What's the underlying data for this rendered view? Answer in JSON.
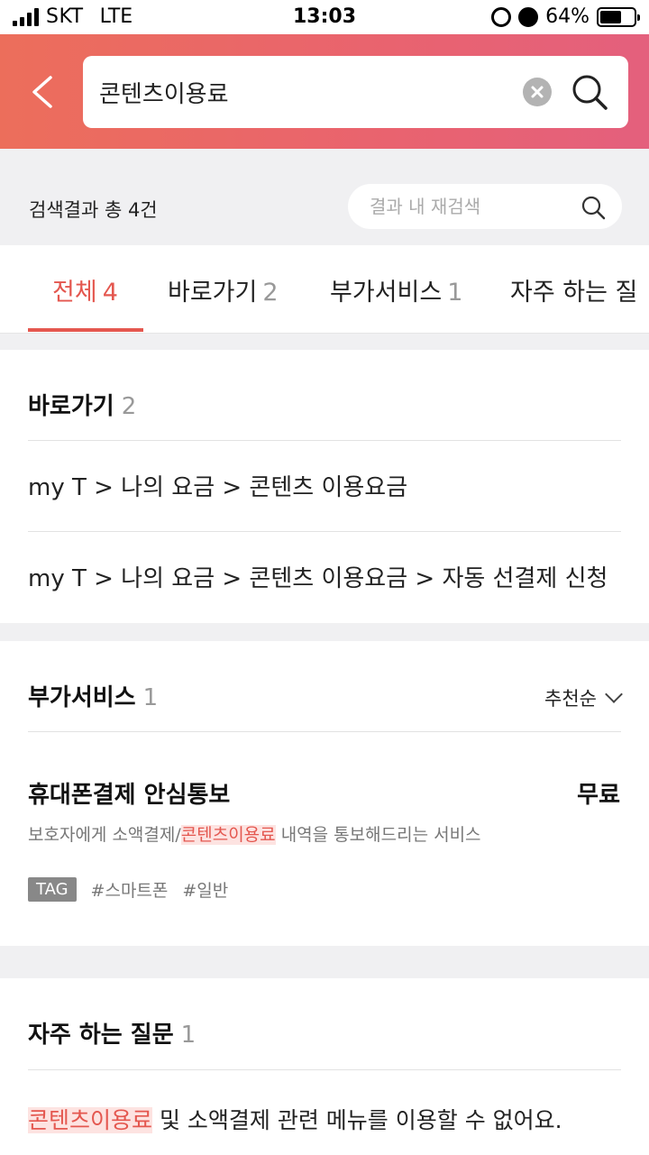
{
  "status_bar": {
    "carrier": "SKT",
    "network": "LTE",
    "time": "13:03",
    "battery": "64%",
    "battery_level": 0.64
  },
  "header": {
    "search_value": "콘텐츠이용료",
    "icons": {
      "back": "chevron-left-icon",
      "clear": "clear-circle-icon",
      "search": "search-icon"
    }
  },
  "results": {
    "count_text": "검색결과 총 4건",
    "research_placeholder": "결과 내 재검색"
  },
  "tabs": [
    {
      "label": "전체",
      "count": "4"
    },
    {
      "label": "바로가기",
      "count": "2"
    },
    {
      "label": "부가서비스",
      "count": "1"
    },
    {
      "label": "자주 하는 질",
      "count": ""
    }
  ],
  "shortcuts": {
    "title": "바로가기",
    "count": "2",
    "items": [
      "my T > 나의 요금 > 콘텐츠 이용요금",
      "my T > 나의 요금 > 콘텐츠 이용요금 > 자동 선결제 신청"
    ]
  },
  "services": {
    "title": "부가서비스",
    "count": "1",
    "sort_label": "추천순",
    "item": {
      "name": "휴대폰결제 안심통보",
      "price": "무료",
      "desc_before": "보호자에게 소액결제/",
      "desc_highlight": "콘텐츠이용료",
      "desc_after": " 내역을 통보해드리는 서비스",
      "tag_label": "TAG",
      "tags": [
        "#스마트폰",
        "#일반"
      ]
    }
  },
  "faq": {
    "title": "자주 하는 질문",
    "count": "1",
    "question_highlight": "콘텐츠이용료",
    "question_rest": " 및 소액결제 관련 메뉴를 이용할 수 없어요."
  },
  "colors": {
    "accent": "#e4574f",
    "header_gradient_start": "#ec6e5b",
    "header_gradient_end": "#e4607d",
    "background_gray": "#f0f0f2"
  }
}
